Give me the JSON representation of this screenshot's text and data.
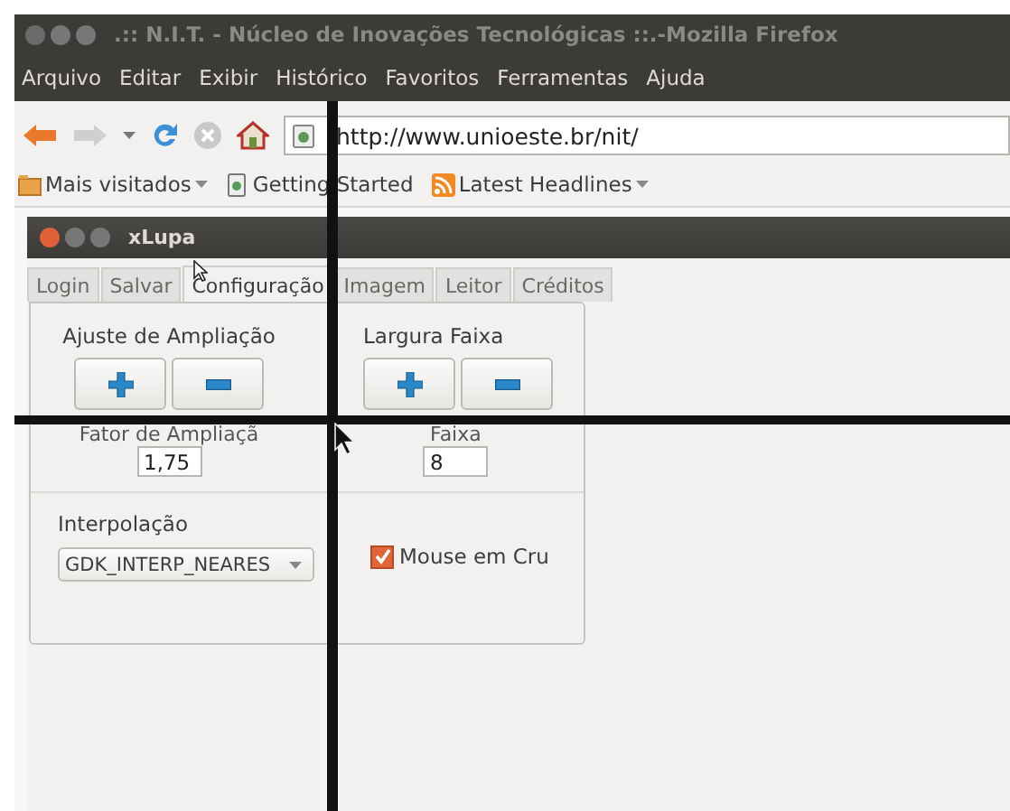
{
  "browser": {
    "title": ".:: N.I.T. - Núcleo de Inovações Tecnológicas ::.-Mozilla Firefox",
    "menu": [
      "Arquivo",
      "Editar",
      "Exibir",
      "Histórico",
      "Favoritos",
      "Ferramentas",
      "Ajuda"
    ],
    "url": "http://www.unioeste.br/nit/",
    "bookmarks": [
      {
        "kind": "folder",
        "label": "Mais visitados",
        "dropdown": true
      },
      {
        "kind": "page",
        "label": "Getting Started",
        "dropdown": false
      },
      {
        "kind": "feed",
        "label": "Latest Headlines",
        "dropdown": true
      }
    ]
  },
  "xlupa": {
    "title": "xLupa",
    "tabs": [
      {
        "label": "Login",
        "selected": false
      },
      {
        "label": "Salvar",
        "selected": false
      },
      {
        "label": "Configuração",
        "selected": true
      },
      {
        "label": "Imagem",
        "selected": false
      },
      {
        "label": "Leitor",
        "selected": false
      },
      {
        "label": "Créditos",
        "selected": false
      }
    ],
    "groups": [
      {
        "title": "Ajuste de Ampliação",
        "value_label": "Fator de Ampliaçã",
        "value": "1,75"
      },
      {
        "title": "Largura Faixa",
        "value_label": "Faixa",
        "value": "8"
      }
    ],
    "interpolation": {
      "label": "Interpolação",
      "value": "GDK_INTERP_NEARES"
    },
    "mouse_cross": {
      "label": "Mouse em Cru",
      "checked": true
    }
  }
}
